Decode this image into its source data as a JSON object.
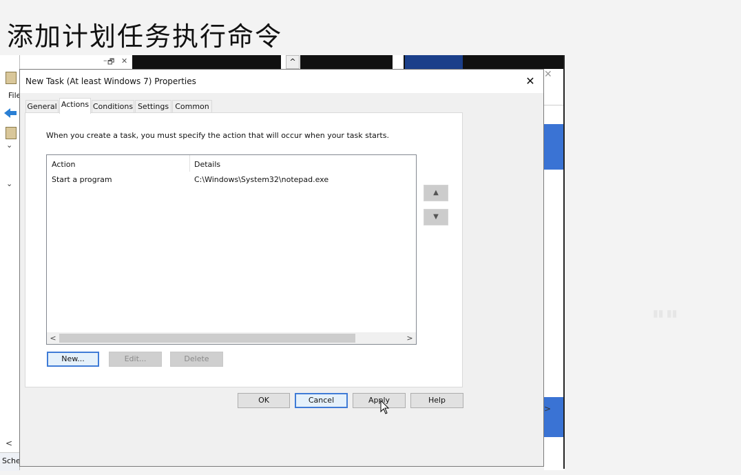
{
  "slide": {
    "title": "添加计划任务执行命令"
  },
  "background": {
    "menu_letters": "File",
    "status_fragment": "Sche",
    "left_scroll_glyph": "<",
    "right_scroll_glyph": ">",
    "minimize_glyph": "–",
    "restore_glyph": "🗗",
    "close_glyph": "✕",
    "up_glyph": "^"
  },
  "dialog": {
    "title": "New Task (At least Windows 7) Properties",
    "close_glyph": "✕",
    "tabs": [
      {
        "label": "General",
        "active": false
      },
      {
        "label": "Actions",
        "active": true
      },
      {
        "label": "Conditions",
        "active": false
      },
      {
        "label": "Settings",
        "active": false
      },
      {
        "label": "Common",
        "active": false
      }
    ],
    "instruction": "When you create a task, you must specify the action that will occur when your task starts.",
    "list": {
      "columns": [
        "Action",
        "Details"
      ],
      "rows": [
        {
          "action": "Start a program",
          "details": "C:\\Windows\\System32\\notepad.exe"
        }
      ],
      "scroll_left": "<",
      "scroll_right": ">"
    },
    "move_up_glyph": "▲",
    "move_down_glyph": "▼",
    "action_buttons": {
      "new": "New...",
      "edit": "Edit...",
      "delete": "Delete"
    },
    "footer_buttons": {
      "ok": "OK",
      "cancel": "Cancel",
      "apply": "Apply",
      "help": "Help"
    }
  },
  "colors": {
    "accent": "#3f7bd6",
    "background_blue": "#3a73d4"
  }
}
